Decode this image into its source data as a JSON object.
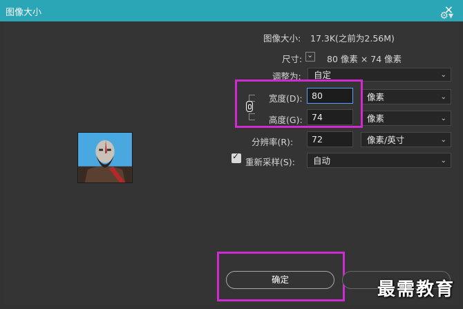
{
  "window": {
    "title": "图像大小",
    "close_symbol": "✕"
  },
  "info": {
    "image_size_label": "图像大小:",
    "image_size_value": "17.3K(之前为2.56M)",
    "dimensions_label": "尺寸:",
    "dimensions_value": "80 像素  ×  74 像素"
  },
  "fit_to": {
    "label": "调整为:",
    "value": "自定"
  },
  "width": {
    "label": "宽度(D):",
    "value": "80",
    "unit": "像素"
  },
  "height": {
    "label": "高度(G):",
    "value": "74",
    "unit": "像素"
  },
  "resolution": {
    "label": "分辨率(R):",
    "value": "72",
    "unit": "像素/英寸"
  },
  "resample": {
    "label": "重新采样(S):",
    "checked": true,
    "value": "自动"
  },
  "buttons": {
    "ok": "确定"
  },
  "watermark": "最需教育",
  "colors": {
    "titlebar": "#2aa6b6",
    "highlight": "#d02bd0",
    "focus": "#5aa0ff"
  },
  "icons": [
    "gear-icon",
    "chevron-down-icon",
    "link-chain-icon",
    "checkbox-check-icon",
    "close-icon"
  ]
}
